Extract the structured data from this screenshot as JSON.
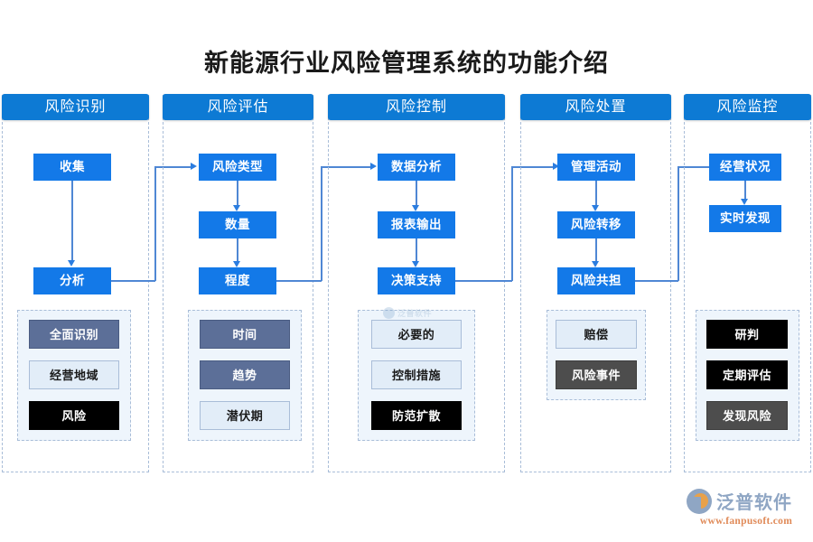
{
  "title": "新能源行业风险管理系统的功能介绍",
  "columns": [
    {
      "header": "风险识别",
      "flow": [
        "收集",
        "分析"
      ],
      "tags": [
        {
          "label": "全面识别",
          "style": "slate"
        },
        {
          "label": "经营地域",
          "style": "light"
        },
        {
          "label": "风险",
          "style": "black"
        }
      ]
    },
    {
      "header": "风险评估",
      "flow": [
        "风险类型",
        "数量",
        "程度"
      ],
      "tags": [
        {
          "label": "时间",
          "style": "slate"
        },
        {
          "label": "趋势",
          "style": "slate"
        },
        {
          "label": "潜伏期",
          "style": "light"
        }
      ]
    },
    {
      "header": "风险控制",
      "flow": [
        "数据分析",
        "报表输出",
        "决策支持"
      ],
      "tags": [
        {
          "label": "必要的",
          "style": "light"
        },
        {
          "label": "控制措施",
          "style": "light"
        },
        {
          "label": "防范扩散",
          "style": "black"
        }
      ]
    },
    {
      "header": "风险处置",
      "flow": [
        "管理活动",
        "风险转移",
        "风险共担"
      ],
      "tags": [
        {
          "label": "赔偿",
          "style": "light"
        },
        {
          "label": "风险事件",
          "style": "gray"
        }
      ]
    },
    {
      "header": "风险监控",
      "flow": [
        "经营状况",
        "实时发现"
      ],
      "tags": [
        {
          "label": "研判",
          "style": "black"
        },
        {
          "label": "定期评估",
          "style": "black"
        },
        {
          "label": "发现风险",
          "style": "gray"
        }
      ]
    }
  ],
  "branding": {
    "logo_name": "泛普软件",
    "logo_url": "www.fanpusoft.com",
    "watermark": "泛普软件"
  },
  "colors": {
    "header_blue": "#0d7ad4",
    "flow_blue": "#1379e8",
    "connector": "#4f87d4",
    "dashed_border": "#a9bdd8",
    "panel_fill": "#eef5fc",
    "slate": "#5c6f98",
    "light": "#e2edf8",
    "black": "#000000",
    "gray": "#4d4d4d"
  }
}
